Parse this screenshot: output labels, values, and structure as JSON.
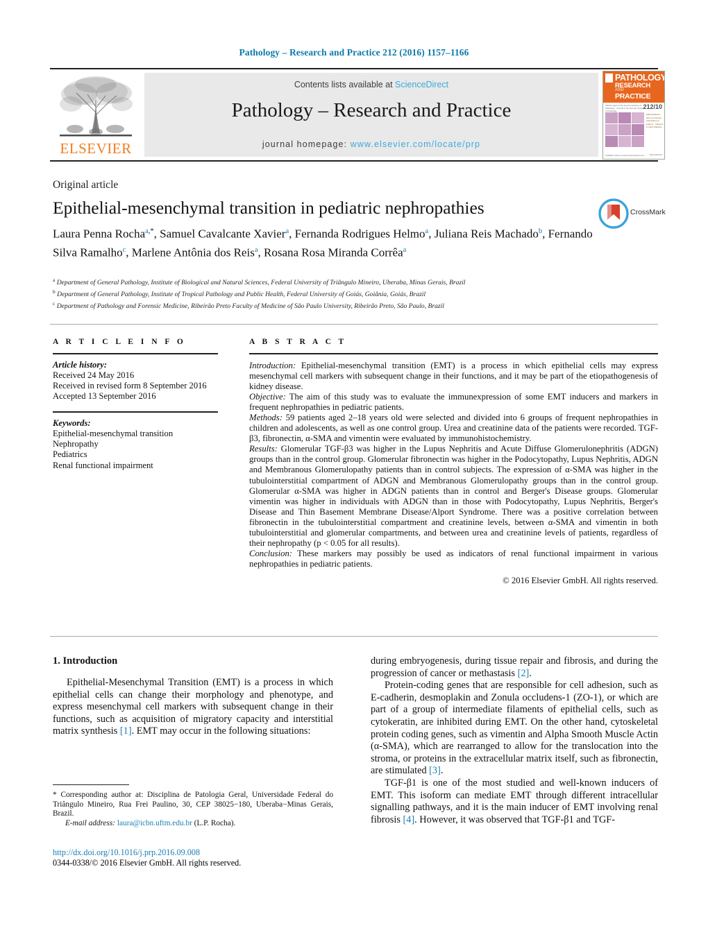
{
  "running_head": "Pathology – Research and Practice 212 (2016) 1157–1166",
  "masthead": {
    "publisher_name": "ELSEVIER",
    "contents_prefix": "Contents lists available at ",
    "contents_link": "ScienceDirect",
    "journal_title": "Pathology – Research and Practice",
    "homepage_prefix": "journal homepage: ",
    "homepage_url": "www.elsevier.com/locate/prp",
    "link_color": "#3ba9dd",
    "cover": {
      "line1": "PATHOLOGY",
      "line2": "RESEARCH",
      "and": "AND",
      "line3": "PRACTICE",
      "issue": "212/10",
      "meta": "Official organ of the German Society of Pathology · Journal of the German Society of Pathology",
      "right_lines": "Editorial Board · Aims and Scope · Instructions to Authors · Indexed in Index Medicus",
      "footer_left": "Available online at www.sciencedirect.com",
      "footer_right": "ScienceDirect",
      "cover_accent": "#e7661f"
    }
  },
  "article": {
    "kind": "Original article",
    "title": "Epithelial-mesenchymal transition in pediatric nephropathies",
    "authors": [
      {
        "name": "Laura Penna Rocha",
        "marks": [
          "a",
          ",*"
        ]
      },
      {
        "name": "Samuel Cavalcante Xavier",
        "marks": [
          "a"
        ]
      },
      {
        "name": "Fernanda Rodrigues Helmo",
        "marks": [
          "a"
        ]
      },
      {
        "name": "Juliana Reis Machado",
        "marks": [
          "b"
        ]
      },
      {
        "name": "Fernando Silva Ramalho",
        "marks": [
          "c"
        ]
      },
      {
        "name": "Marlene Antônia dos Reis",
        "marks": [
          "a"
        ]
      },
      {
        "name": "Rosana Rosa Miranda Corrêa",
        "marks": [
          "a"
        ]
      }
    ],
    "affiliations": [
      {
        "mark": "a",
        "text": "Department of General Pathology, Institute of Biological and Natural Sciences, Federal University of Triângulo Mineiro, Uberaba, Minas Gerais, Brazil"
      },
      {
        "mark": "b",
        "text": "Department of General Pathology, Institute of Tropical Pathology and Public Health, Federal University of Goiás, Goiânia, Goiás, Brazil"
      },
      {
        "mark": "c",
        "text": "Department of Pathology and Forensic Medicine, Ribeirão Preto Faculty of Medicine of São Paulo University, Ribeirão Preto, São Paulo, Brazil"
      }
    ],
    "crossmark_label": "CrossMark"
  },
  "article_info": {
    "heading": "A R T I C L E   I N F O",
    "history_label": "Article history:",
    "history": [
      "Received 24 May 2016",
      "Received in revised form 8 September 2016",
      "Accepted 13 September 2016"
    ],
    "keywords_label": "Keywords:",
    "keywords": [
      "Epithelial-mesenchymal transition",
      "Nephropathy",
      "Pediatrics",
      "Renal functional impairment"
    ]
  },
  "abstract": {
    "heading": "A B S T R A C T",
    "sections": [
      {
        "label": "Introduction:",
        "text": " Epithelial-mesenchymal transition (EMT) is a process in which epithelial cells may express mesenchymal cell markers with subsequent change in their functions, and it may be part of the etiopathogenesis of kidney disease."
      },
      {
        "label": "Objective:",
        "text": " The aim of this study was to evaluate the immunexpression of some EMT inducers and markers in frequent nephropathies in pediatric patients."
      },
      {
        "label": "Methods:",
        "text": " 59 patients aged 2–18 years old were selected and divided into 6 groups of frequent nephropathies in children and adolescents, as well as one control group. Urea and creatinine data of the patients were recorded. TGF-β3, fibronectin, α-SMA and vimentin were evaluated by immunohistochemistry."
      },
      {
        "label": "Results:",
        "text": " Glomerular TGF-β3 was higher in the Lupus Nephritis and Acute Diffuse Glomerulonephritis (ADGN) groups than in the control group. Glomerular fibronectin was higher in the Podocytopathy, Lupus Nephritis, ADGN and Membranous Glomerulopathy patients than in control subjects. The expression of α-SMA was higher in the tubulointerstitial compartment of ADGN and Membranous Glomerulopathy groups than in the control group. Glomerular α-SMA was higher in ADGN patients than in control and Berger's Disease groups. Glomerular vimentin was higher in individuals with ADGN than in those with Podocytopathy, Lupus Nephritis, Berger's Disease and Thin Basement Membrane Disease/Alport Syndrome. There was a positive correlation between fibronectin in the tubulointerstitial compartment and creatinine levels, between α-SMA and vimentin in both tubulointerstitial and glomerular compartments, and between urea and creatinine levels of patients, regardless of their nephropathy (p < 0.05 for all results)."
      },
      {
        "label": "Conclusion:",
        "text": " These markers may possibly be used as indicators of renal functional impairment in various nephropathies in pediatric patients."
      }
    ],
    "copyright": "© 2016 Elsevier GmbH. All rights reserved."
  },
  "body": {
    "section_heading": "1.  Introduction",
    "left_paragraphs": [
      "Epithelial-Mesenchymal Transition (EMT) is a process in which epithelial cells can change their morphology and phenotype, and express mesenchymal cell markers with subsequent change in their functions, such as acquisition of migratory capacity and interstitial matrix synthesis [1]. EMT may occur in the following situations:"
    ],
    "right_paragraphs": [
      "during embryogenesis, during tissue repair and fibrosis, and during the progression of cancer or methastasis [2].",
      "Protein-coding genes that are responsible for cell adhesion, such as E-cadherin, desmoplakin and Zonula occludens-1 (ZO-1), or which are part of a group of intermediate filaments of epithelial cells, such as cytokeratin, are inhibited during EMT. On the other hand, cytoskeletal protein coding genes, such as vimentin and Alpha Smooth Muscle Actin (α-SMA), which are rearranged to allow for the translocation into the stroma, or proteins in the extracellular matrix itself, such as fibronectin, are stimulated [3].",
      "TGF-β1 is one of the most studied and well-known inducers of EMT. This isoform can mediate EMT through different intracellular signalling pathways, and it is the main inducer of EMT involving renal fibrosis [4]. However, it was observed that TGF-β1 and TGF-"
    ]
  },
  "footnotes": {
    "corresponding": "* Corresponding author at: Disciplina de Patologia Geral, Universidade Federal do Triângulo Mineiro, Rua Frei Paulino, 30, CEP 38025−180, Uberaba−Minas Gerais, Brazil.",
    "email_label": "E-mail address:",
    "email": "laura@icbn.uftm.edu.br",
    "email_suffix": " (L.P. Rocha).",
    "doi": "http://dx.doi.org/10.1016/j.prp.2016.09.008",
    "issn_line": "0344-0338/© 2016 Elsevier GmbH. All rights reserved."
  }
}
